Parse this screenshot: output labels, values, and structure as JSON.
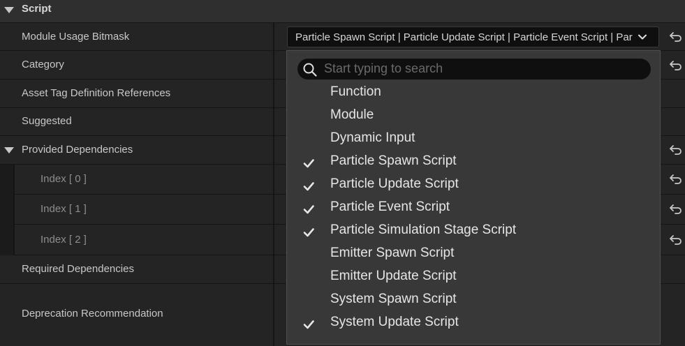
{
  "section": {
    "title": "Script"
  },
  "rows": {
    "module_usage_bitmask": "Module Usage Bitmask",
    "category": "Category",
    "asset_tag_definition_references": "Asset Tag Definition References",
    "suggested": "Suggested",
    "provided_dependencies": "Provided Dependencies",
    "index_0": "Index [ 0 ]",
    "index_1": "Index [ 1 ]",
    "index_2": "Index [ 2 ]",
    "required_dependencies": "Required Dependencies",
    "deprecation_recommendation": "Deprecation Recommendation"
  },
  "combo": {
    "value": "Particle Spawn Script | Particle Update Script | Particle Event Script | Particle Simulation Stage Script | System Update Script"
  },
  "dropdown": {
    "search_placeholder": "Start typing to search",
    "options": [
      {
        "label": "Function",
        "checked": false
      },
      {
        "label": "Module",
        "checked": false
      },
      {
        "label": "Dynamic Input",
        "checked": false
      },
      {
        "label": "Particle Spawn Script",
        "checked": true
      },
      {
        "label": "Particle Update Script",
        "checked": true
      },
      {
        "label": "Particle Event Script",
        "checked": true
      },
      {
        "label": "Particle Simulation Stage Script",
        "checked": true
      },
      {
        "label": "Emitter Spawn Script",
        "checked": false
      },
      {
        "label": "Emitter Update Script",
        "checked": false
      },
      {
        "label": "System Spawn Script",
        "checked": false
      },
      {
        "label": "System Update Script",
        "checked": true
      }
    ]
  },
  "icons": {
    "expand": "triangle-down-icon",
    "reset": "reset-to-default-icon",
    "chevron": "chevron-down-icon",
    "search": "search-icon",
    "check": "checkmark-icon"
  }
}
